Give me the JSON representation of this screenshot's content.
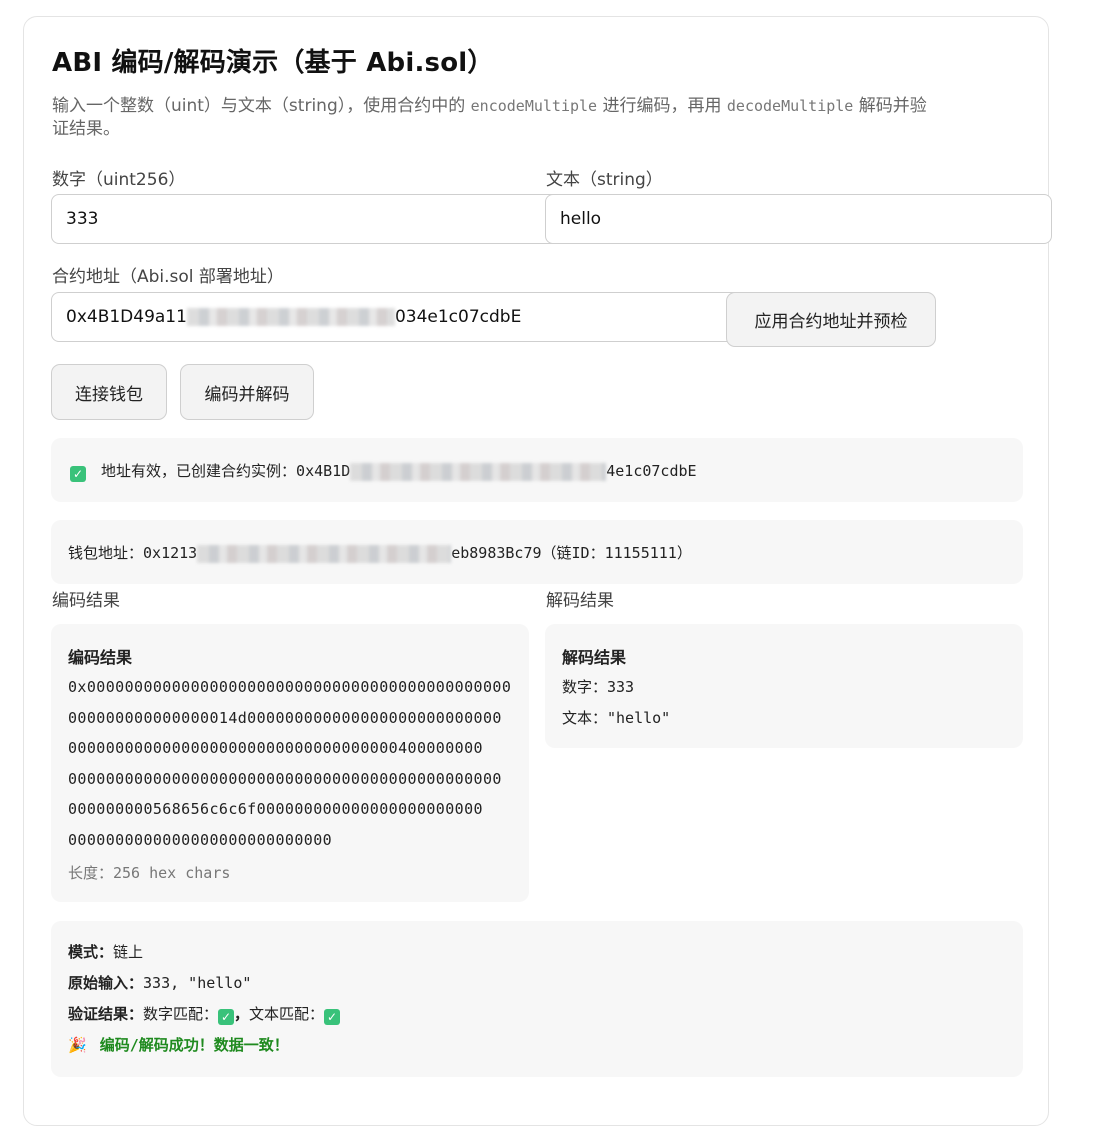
{
  "page": {
    "title": "ABI 编码/解码演示（基于 Abi.sol）",
    "desc_part1": "输入一个整数（uint）与文本（string），使用合约中的 ",
    "desc_code1": "encodeMultiple",
    "desc_part2": " 进行编码，再用 ",
    "desc_code2": "decodeMultiple",
    "desc_part3": " 解码并验",
    "desc_part4": "证结果。"
  },
  "form": {
    "number_label": "数字（uint256）",
    "number_value": "333",
    "text_label": "文本（string）",
    "text_value": "hello",
    "address_label": "合约地址（Abi.sol 部署地址）",
    "address_prefix": "0x4B1D49a11",
    "address_suffix": "034e1c07cdbE",
    "apply_button": "应用合约地址并预检",
    "connect_button": "连接钱包",
    "encode_decode_button": "编码并解码"
  },
  "status": {
    "address_ok_text": "地址有效，已创建合约实例：",
    "address_ok_prefix": "0x4B1D",
    "address_ok_suffix": "4e1c07cdbE",
    "wallet_label": "钱包地址：",
    "wallet_prefix": "0x1213",
    "wallet_suffix": "eb8983Bc79（链ID：11155111）"
  },
  "encode": {
    "section_label": "编码结果",
    "heading": "编码结果",
    "hex_lines": [
      "0x000000000000000000000000000000000000000000000",
      "000000000000000014d000000000000000000000000000",
      "00000000000000000000000000000000000400000000",
      "0000000000000000000000000000000000000000000000",
      "000000000568656c6c6f000000000000000000000000",
      "0000000000000000000000000000"
    ],
    "length_text": "长度：256 hex chars"
  },
  "decode": {
    "section_label": "解码结果",
    "heading": "解码结果",
    "number_line": "数字：333",
    "text_line": "文本：\"hello\""
  },
  "summary": {
    "mode_label": "模式：",
    "mode_value": "链上",
    "input_label": "原始输入：",
    "input_value": "333, \"hello\"",
    "verify_label": "验证结果：",
    "verify_number": "数字匹配：",
    "verify_sep": "，",
    "verify_text": "文本匹配：",
    "success_emoji": "🎉",
    "success_text": "编码/解码成功！数据一致！"
  },
  "icons": {
    "check": "check-mark-icon",
    "party": "party-popper-icon",
    "check_color": "#39c27a",
    "success_color": "#1f8a1f"
  }
}
